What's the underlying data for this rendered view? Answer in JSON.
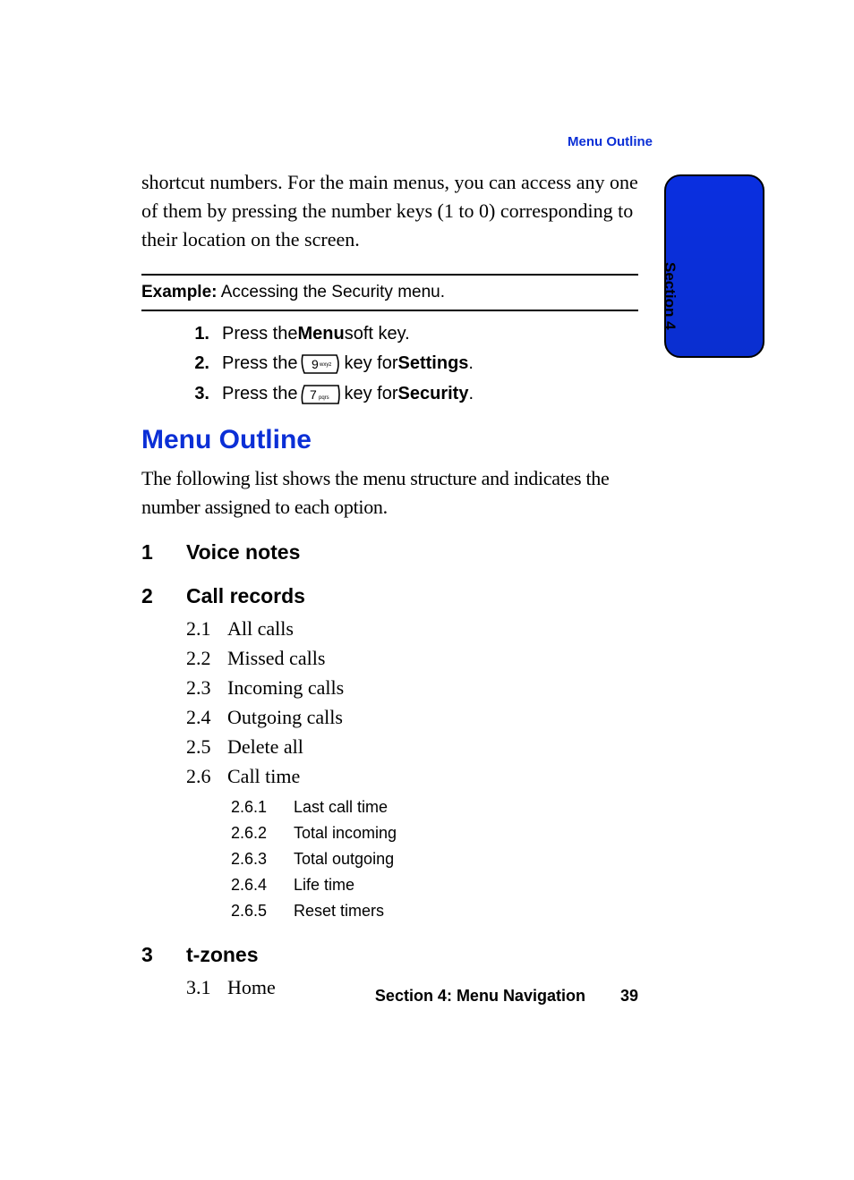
{
  "running_head": "Menu Outline",
  "intro_paragraph": "shortcut numbers. For the main menus, you can access any one of them by pressing the number keys (1 to 0) corresponding to their location on the screen.",
  "example": {
    "label": "Example:",
    "text": " Accessing the Security menu."
  },
  "steps": [
    {
      "num": "1.",
      "pre": "Press the ",
      "bold": "Menu",
      "post": " soft key."
    },
    {
      "num": "2.",
      "pre": "Press the ",
      "key": "9",
      "key_sub": "wxyz",
      "mid": " key for ",
      "bold": "Settings",
      "post": "."
    },
    {
      "num": "3.",
      "pre": "Press the ",
      "key": "7",
      "key_sub": "pqrs",
      "mid": " key for ",
      "bold": "Security",
      "post": "."
    }
  ],
  "h2": "Menu Outline",
  "outline_intro": "The following list shows the menu structure and indicates the number assigned to each option.",
  "menu": [
    {
      "num": "1",
      "title": "Voice notes",
      "items": []
    },
    {
      "num": "2",
      "title": "Call records",
      "items": [
        {
          "num": "2.1",
          "label": "All calls"
        },
        {
          "num": "2.2",
          "label": "Missed calls"
        },
        {
          "num": "2.3",
          "label": "Incoming calls"
        },
        {
          "num": "2.4",
          "label": "Outgoing calls"
        },
        {
          "num": "2.5",
          "label": "Delete all"
        },
        {
          "num": "2.6",
          "label": "Call time",
          "items": [
            {
              "num": "2.6.1",
              "label": "Last call time"
            },
            {
              "num": "2.6.2",
              "label": "Total incoming"
            },
            {
              "num": "2.6.3",
              "label": "Total outgoing"
            },
            {
              "num": "2.6.4",
              "label": "Life time"
            },
            {
              "num": "2.6.5",
              "label": "Reset timers"
            }
          ]
        }
      ]
    },
    {
      "num": "3",
      "title": "t-zones",
      "items": [
        {
          "num": "3.1",
          "label": "Home"
        }
      ]
    }
  ],
  "side_tab": "Section 4",
  "footer": {
    "section": "Section 4: Menu Navigation",
    "page": "39"
  }
}
